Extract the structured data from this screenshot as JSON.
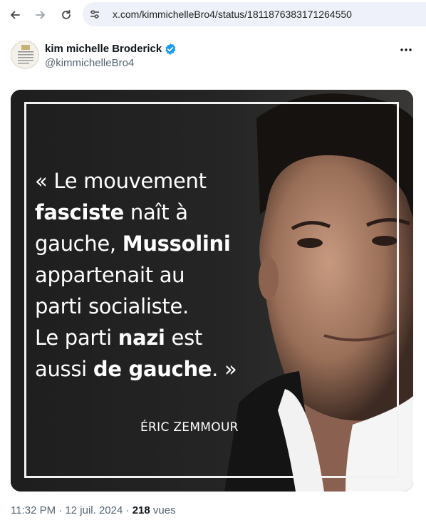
{
  "browser": {
    "url": "x.com/kimmichelleBro4/status/1811876383171264550",
    "back_icon": "arrow-left-icon",
    "forward_icon": "arrow-right-icon",
    "reload_icon": "reload-icon",
    "site_info_icon": "tune-icon"
  },
  "tweet": {
    "display_name": "kim michelle Broderick",
    "handle": "@kimmichelleBro4",
    "verified_color": "#1d9bf0",
    "more_icon": "more-horizontal-icon",
    "image": {
      "quote": {
        "open": "« ",
        "p1": "Le mouvement",
        "b1": "fasciste",
        "p2": " naît à",
        "p3": "gauche, ",
        "b2": "Mussolini",
        "p4": "appartenait au",
        "p5": "parti socialiste.",
        "p6": "Le parti ",
        "b3": "nazi",
        "p7": " est",
        "p8": "aussi ",
        "b4": "de gauche",
        "p9": ". »"
      },
      "author": "ÉRIC ZEMMOUR"
    },
    "time": "11:32 PM",
    "sep1": " · ",
    "date": "12 juil. 2024",
    "sep2": " · ",
    "views_count": "218",
    "views_label": " vues"
  }
}
